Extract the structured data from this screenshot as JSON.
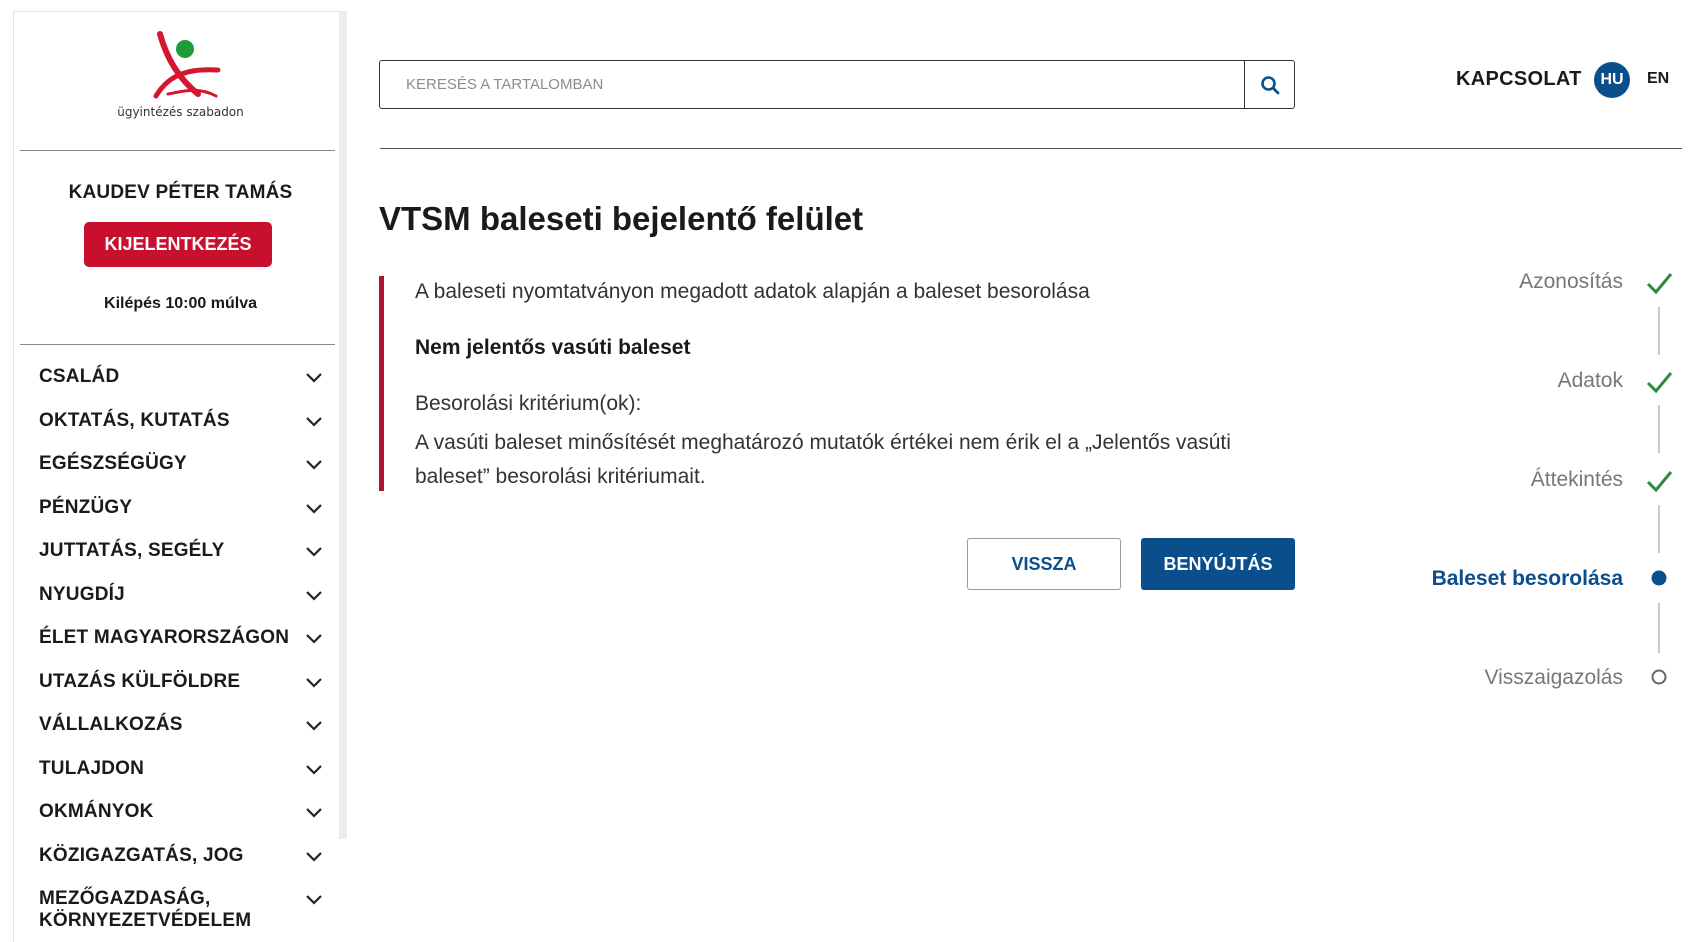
{
  "brand": {
    "logo_caption": "ügyintézés szabadon"
  },
  "user": {
    "name": "KAUDEV PÉTER TAMÁS",
    "logout_label": "KIJELENTKEZÉS",
    "session_timer": "Kilépés 10:00 múlva"
  },
  "nav": {
    "items": [
      {
        "label": "CSALÁD"
      },
      {
        "label": "OKTATÁS, KUTATÁS"
      },
      {
        "label": "EGÉSZSÉGÜGY"
      },
      {
        "label": "PÉNZÜGY"
      },
      {
        "label": "JUTTATÁS, SEGÉLY"
      },
      {
        "label": "NYUGDÍJ"
      },
      {
        "label": "ÉLET MAGYARORSZÁGON"
      },
      {
        "label": "UTAZÁS KÜLFÖLDRE"
      },
      {
        "label": "VÁLLALKOZÁS"
      },
      {
        "label": "TULAJDON"
      },
      {
        "label": "OKMÁNYOK"
      },
      {
        "label": "KÖZIGAZGATÁS, JOG"
      },
      {
        "label": "MEZŐGAZDASÁG,",
        "label_line2": "KÖRNYEZETVÉDELEM"
      }
    ]
  },
  "header": {
    "search_placeholder": "KERESÉS A TARTALOMBAN",
    "contact_label": "KAPCSOLAT",
    "lang_hu": "HU",
    "lang_en": "EN"
  },
  "main": {
    "title": "VTSM baleseti bejelentő felület",
    "notice": {
      "intro": "A baleseti nyomtatványon megadott adatok alapján a baleset besorolása",
      "classification": "Nem jelentős vasúti baleset",
      "criteria_label": "Besorolási kritérium(ok):",
      "criteria_text": "A vasúti baleset minősítését meghatározó mutatók értékei nem érik el a „Jelentős vasúti baleset” besorolási kritériumait."
    },
    "buttons": {
      "back": "VISSZA",
      "submit": "BENYÚJTÁS"
    }
  },
  "stepper": {
    "steps": [
      {
        "label": "Azonosítás",
        "status": "done"
      },
      {
        "label": "Adatok",
        "status": "done"
      },
      {
        "label": "Áttekintés",
        "status": "done"
      },
      {
        "label": "Baleset besorolása",
        "status": "current"
      },
      {
        "label": "Visszaigazolás",
        "status": "pending"
      }
    ]
  },
  "colors": {
    "primary_blue": "#0a4e8c",
    "logout_red": "#c8102e",
    "notice_border": "#b0132f",
    "done_green": "#2e8b3d"
  }
}
